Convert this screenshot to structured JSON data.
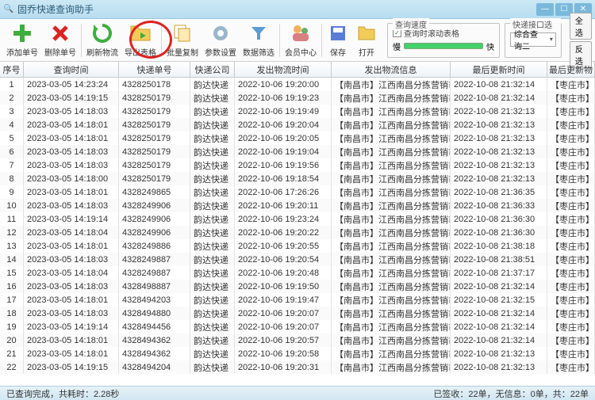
{
  "window": {
    "title": "固乔快递查询助手"
  },
  "toolbar": {
    "add": "添加单号",
    "delete": "删除单号",
    "refresh": "刷新物流",
    "export": "导出表格",
    "batch": "批量复制",
    "settings": "参数设置",
    "filter": "数据筛选",
    "member": "会员中心",
    "save": "保存",
    "open": "打开"
  },
  "speed": {
    "legend": "查询速度",
    "checkbox": "查询时滚动表格",
    "slow": "慢",
    "fast": "快"
  },
  "port": {
    "legend": "快递接口选择",
    "selected": "综合查询二"
  },
  "side": {
    "selectall": "全选",
    "invert": "反选"
  },
  "columns": {
    "seq": "序号",
    "querytime": "查询时间",
    "trackno": "快递单号",
    "company": "快递公司",
    "sendtime": "发出物流时间",
    "sendinfo": "发出物流信息",
    "updatetime": "最后更新时间",
    "updateinfo": "最后更新物"
  },
  "rows": [
    {
      "seq": "1",
      "qt": "2023-03-05 14:23:24",
      "tn": "4328250178",
      "co": "韵达快递",
      "st": "2022-10-06 19:20:00",
      "si": "【南昌市】江西南昌分拣营销市…",
      "ut": "2022-10-08 21:32:14",
      "ui": "【枣庄市】"
    },
    {
      "seq": "2",
      "qt": "2023-03-05 14:19:15",
      "tn": "4328250179",
      "co": "韵达快递",
      "st": "2022-10-06 19:19:23",
      "si": "【南昌市】江西南昌分拣营销市…",
      "ut": "2022-10-08 21:32:14",
      "ui": "【枣庄市】"
    },
    {
      "seq": "3",
      "qt": "2023-03-05 14:18:03",
      "tn": "4328250179",
      "co": "韵达快递",
      "st": "2022-10-06 19:19:49",
      "si": "【南昌市】江西南昌分拣营销市…",
      "ut": "2022-10-08 21:32:13",
      "ui": "【枣庄市】"
    },
    {
      "seq": "4",
      "qt": "2023-03-05 14:18:01",
      "tn": "4328250179",
      "co": "韵达快递",
      "st": "2022-10-06 19:20:04",
      "si": "【南昌市】江西南昌分拣营销市…",
      "ut": "2022-10-08 21:32:13",
      "ui": "【枣庄市】"
    },
    {
      "seq": "5",
      "qt": "2023-03-05 14:18:01",
      "tn": "4328250179",
      "co": "韵达快递",
      "st": "2022-10-06 19:20:05",
      "si": "【南昌市】江西南昌分拣营销市…",
      "ut": "2022-10-08 21:32:13",
      "ui": "【枣庄市】"
    },
    {
      "seq": "6",
      "qt": "2023-03-05 14:18:03",
      "tn": "4328250179",
      "co": "韵达快递",
      "st": "2022-10-06 19:19:04",
      "si": "【南昌市】江西南昌分拣营销市…",
      "ut": "2022-10-08 21:32:13",
      "ui": "【枣庄市】"
    },
    {
      "seq": "7",
      "qt": "2023-03-05 14:18:03",
      "tn": "4328250179",
      "co": "韵达快递",
      "st": "2022-10-06 19:19:56",
      "si": "【南昌市】江西南昌分拣营销市…",
      "ut": "2022-10-08 21:32:13",
      "ui": "【枣庄市】"
    },
    {
      "seq": "8",
      "qt": "2023-03-05 14:18:00",
      "tn": "4328250179",
      "co": "韵达快递",
      "st": "2022-10-06 19:18:54",
      "si": "【南昌市】江西南昌分拣营销市…",
      "ut": "2022-10-08 21:32:13",
      "ui": "【枣庄市】"
    },
    {
      "seq": "9",
      "qt": "2023-03-05 14:18:01",
      "tn": "4328249865",
      "co": "韵达快递",
      "st": "2022-10-06 17:26:26",
      "si": "【南昌市】江西南昌分拣营销市…",
      "ut": "2022-10-08 21:36:35",
      "ui": "【枣庄市】"
    },
    {
      "seq": "10",
      "qt": "2023-03-05 14:18:03",
      "tn": "4328249906",
      "co": "韵达快递",
      "st": "2022-10-06 19:20:11",
      "si": "【南昌市】江西南昌分拣营销市…",
      "ut": "2022-10-08 21:36:33",
      "ui": "【枣庄市】"
    },
    {
      "seq": "11",
      "qt": "2023-03-05 14:19:14",
      "tn": "4328249906",
      "co": "韵达快递",
      "st": "2022-10-06 19:23:24",
      "si": "【南昌市】江西南昌分拣营销市…",
      "ut": "2022-10-08 21:36:30",
      "ui": "【枣庄市】"
    },
    {
      "seq": "12",
      "qt": "2023-03-05 14:18:04",
      "tn": "4328249906",
      "co": "韵达快递",
      "st": "2022-10-06 19:20:22",
      "si": "【南昌市】江西南昌分拣营销市…",
      "ut": "2022-10-08 21:36:30",
      "ui": "【枣庄市】"
    },
    {
      "seq": "13",
      "qt": "2023-03-05 14:18:01",
      "tn": "4328249886",
      "co": "韵达快递",
      "st": "2022-10-06 19:20:55",
      "si": "【南昌市】江西南昌分拣营销市…",
      "ut": "2022-10-08 21:38:18",
      "ui": "【枣庄市】"
    },
    {
      "seq": "14",
      "qt": "2023-03-05 14:18:03",
      "tn": "4328249887",
      "co": "韵达快递",
      "st": "2022-10-06 19:20:54",
      "si": "【南昌市】江西南昌分拣营销市…",
      "ut": "2022-10-08 21:38:51",
      "ui": "【枣庄市】"
    },
    {
      "seq": "15",
      "qt": "2023-03-05 14:18:04",
      "tn": "4328249887",
      "co": "韵达快递",
      "st": "2022-10-06 19:20:48",
      "si": "【南昌市】江西南昌分拣营销市…",
      "ut": "2022-10-08 21:37:17",
      "ui": "【枣庄市】"
    },
    {
      "seq": "16",
      "qt": "2023-03-05 14:18:03",
      "tn": "4328498887",
      "co": "韵达快递",
      "st": "2022-10-06 19:19:50",
      "si": "【南昌市】江西南昌分拣营销市…",
      "ut": "2022-10-08 21:32:14",
      "ui": "【枣庄市】"
    },
    {
      "seq": "17",
      "qt": "2023-03-05 14:18:01",
      "tn": "4328494203",
      "co": "韵达快递",
      "st": "2022-10-06 19:19:47",
      "si": "【南昌市】江西南昌分拣营销市…",
      "ut": "2022-10-08 21:32:15",
      "ui": "【枣庄市】"
    },
    {
      "seq": "18",
      "qt": "2023-03-05 14:18:03",
      "tn": "4328494880",
      "co": "韵达快递",
      "st": "2022-10-06 19:20:07",
      "si": "【南昌市】江西南昌分拣营销市…",
      "ut": "2022-10-08 21:32:14",
      "ui": "【枣庄市】"
    },
    {
      "seq": "19",
      "qt": "2023-03-05 14:19:14",
      "tn": "4328494456",
      "co": "韵达快递",
      "st": "2022-10-06 19:20:07",
      "si": "【南昌市】江西南昌分拣营销市…",
      "ut": "2022-10-08 21:32:14",
      "ui": "【枣庄市】"
    },
    {
      "seq": "20",
      "qt": "2023-03-05 14:18:01",
      "tn": "4328494362",
      "co": "韵达快递",
      "st": "2022-10-06 19:20:57",
      "si": "【南昌市】江西南昌分拣营销市…",
      "ut": "2022-10-08 21:32:14",
      "ui": "【枣庄市】"
    },
    {
      "seq": "21",
      "qt": "2023-03-05 14:18:01",
      "tn": "4328494362",
      "co": "韵达快递",
      "st": "2022-10-06 19:20:58",
      "si": "【南昌市】江西南昌分拣营销市…",
      "ut": "2022-10-08 21:32:13",
      "ui": "【枣庄市】"
    },
    {
      "seq": "22",
      "qt": "2023-03-05 14:19:15",
      "tn": "4328494204",
      "co": "韵达快递",
      "st": "2022-10-06 19:20:31",
      "si": "【南昌市】江西南昌分拣营销市…",
      "ut": "2022-10-08 21:32:13",
      "ui": "【枣庄市】"
    }
  ],
  "status": {
    "left": "已查询完成，共耗时：2.28秒",
    "right": "已签收：22单，无信息：0单，共：22单"
  }
}
